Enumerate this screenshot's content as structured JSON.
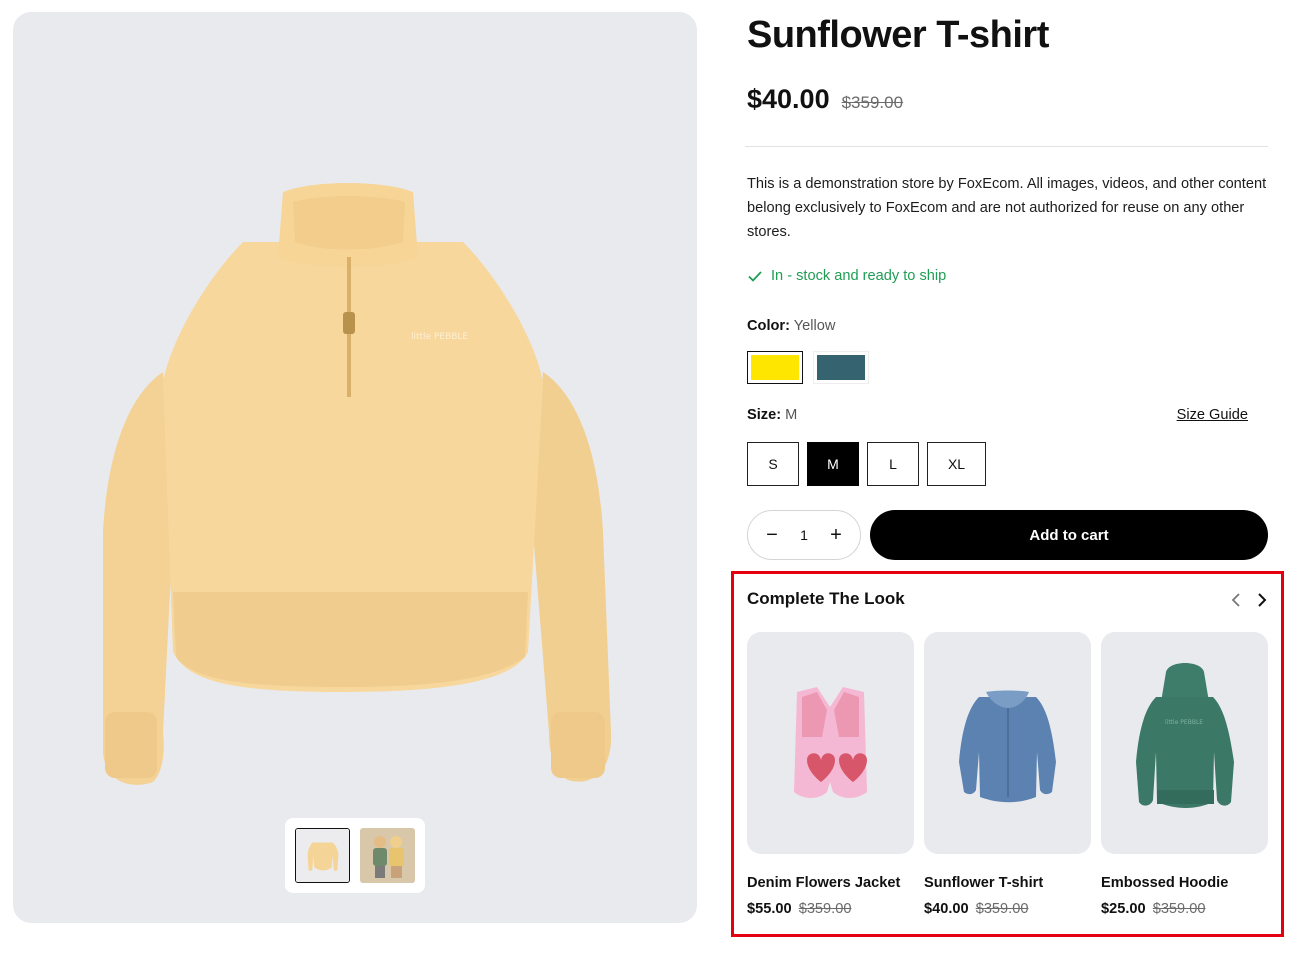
{
  "product": {
    "title": "Sunflower T-shirt",
    "price": "$40.00",
    "compare_price": "$359.00",
    "description": "This is a demonstration store by FoxEcom. All images, videos, and other content belong exclusively to FoxEcom and are not authorized for reuse on any other stores.",
    "stock_text": "In - stock and ready to ship",
    "image_brand_text": "little PEBBLE"
  },
  "color": {
    "label": "Color:",
    "value": "Yellow",
    "swatches": [
      {
        "name": "Yellow",
        "hex": "#ffe600"
      },
      {
        "name": "Teal",
        "hex": "#35636f"
      }
    ]
  },
  "size": {
    "label": "Size:",
    "value": "M",
    "guide_label": "Size Guide",
    "options": [
      "S",
      "M",
      "L",
      "XL"
    ]
  },
  "cart": {
    "quantity": "1",
    "minus": "−",
    "plus": "+",
    "add_label": "Add to cart"
  },
  "complete_the_look": {
    "title": "Complete The Look",
    "items": [
      {
        "name": "Denim Flowers Jacket",
        "price": "$55.00",
        "compare_price": "$359.00"
      },
      {
        "name": "Sunflower T-shirt",
        "price": "$40.00",
        "compare_price": "$359.00"
      },
      {
        "name": "Embossed Hoodie",
        "price": "$25.00",
        "compare_price": "$359.00"
      }
    ]
  },
  "colors": {
    "accent_red": "#e4000f",
    "stock_green": "#1f9d55",
    "gallery_bg": "#e9eaee"
  }
}
